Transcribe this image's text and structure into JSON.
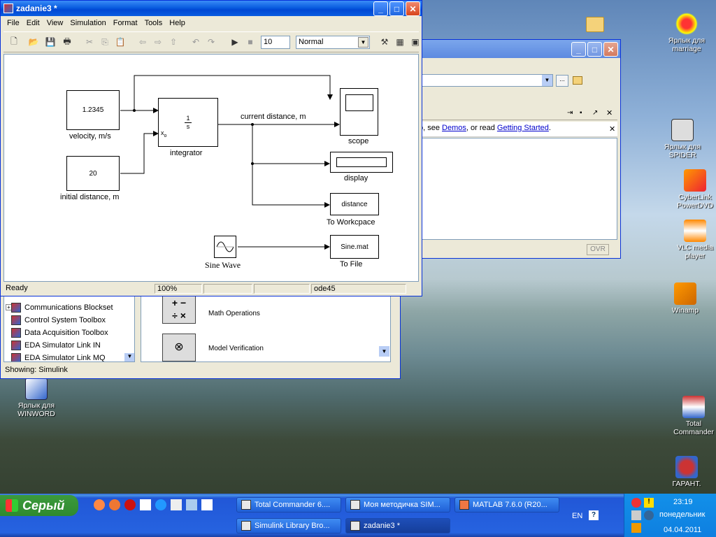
{
  "simulink_window": {
    "title": "zadanie3 *",
    "menu": [
      "File",
      "Edit",
      "View",
      "Simulation",
      "Format",
      "Tools",
      "Help"
    ],
    "stop_time": "10",
    "sim_mode": "Normal",
    "status": {
      "state": "Ready",
      "zoom": "100%",
      "solver": "ode45"
    }
  },
  "diagram": {
    "velocity_value": "1.2345",
    "velocity_label": "velocity, m/s",
    "initial_value": "20",
    "initial_label": "initial distance, m",
    "integrator_num": "1",
    "integrator_den": "s",
    "integrator_port": "x",
    "integrator_port_sub": "o",
    "integrator_label": "integrator",
    "signal_label": "current distance, m",
    "scope_label": "scope",
    "display_label": "display",
    "workspace_value": "distance",
    "workspace_label": "To Workcpace",
    "sine_label": "Sine Wave",
    "file_value": "Sine.mat",
    "file_label": "To File"
  },
  "matlab_window": {
    "help_text_1": "o, see ",
    "help_link_1": "Demos",
    "help_text_2": ", or read ",
    "help_link_2": "Getting Started",
    "help_text_3": ".",
    "ovr": "OVR"
  },
  "library_browser": {
    "tree": [
      "Communications Blockset",
      "Control System Toolbox",
      "Data Acquisition Toolbox",
      "EDA Simulator Link IN",
      "EDA Simulator Link MQ"
    ],
    "blocks": [
      "Math Operations",
      "Model Verification"
    ],
    "status": "Showing: Simulink"
  },
  "desktop_icons": {
    "marriage": "Ярлык для marriage",
    "spider": "Ярлык для SPIDER",
    "cyberlink": "CyberLink PowerDVD",
    "vlc": "VLC media player",
    "winamp": "Winamp",
    "winword": "Ярлык для WINWORD",
    "totalcmd": "Total Commander",
    "garant": "ГАРАНТ."
  },
  "taskbar": {
    "start": "Серый",
    "tasks": [
      "Total Commander 6....",
      "Моя методичка SIM...",
      "MATLAB  7.6.0 (R20...",
      "Simulink Library Bro...",
      "zadanie3 *"
    ],
    "lang": "EN",
    "time": "23:19",
    "day": "понедельник",
    "date": "04.04.2011"
  }
}
